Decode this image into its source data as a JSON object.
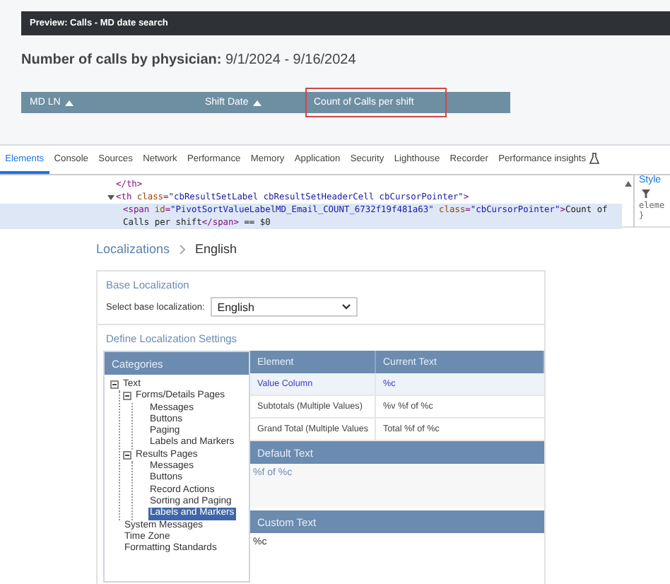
{
  "preview": {
    "title": "Preview: Calls - MD date search",
    "heading": "**Number of calls by physician:** 9/1/2024 - 9/16/2024",
    "columns": [
      {
        "label": "MD LN",
        "sorted": true,
        "highlighted": false
      },
      {
        "label": "Shift Date",
        "sorted": true,
        "highlighted": false
      },
      {
        "label": "Count of Calls per shift",
        "sorted": false,
        "highlighted": true
      }
    ]
  },
  "devtools": {
    "tabs": [
      {
        "label": "Elements",
        "selected": true
      },
      {
        "label": "Console",
        "selected": false
      },
      {
        "label": "Sources",
        "selected": false
      },
      {
        "label": "Network",
        "selected": false
      },
      {
        "label": "Performance",
        "selected": false
      },
      {
        "label": "Memory",
        "selected": false
      },
      {
        "label": "Application",
        "selected": false
      },
      {
        "label": "Security",
        "selected": false
      },
      {
        "label": "Lighthouse",
        "selected": false
      },
      {
        "label": "Recorder",
        "selected": false
      },
      {
        "label": "Performance insights",
        "selected": false,
        "kind": "experimental"
      }
    ],
    "code_lines": [
      {
        "selected": false,
        "parts": [
          {
            "kind": "tag",
            "text": "</th>"
          }
        ]
      },
      {
        "expanded": true,
        "selected": false,
        "parts": [
          {
            "kind": "tag",
            "text": "<th "
          },
          {
            "kind": "attr",
            "text": "class"
          },
          {
            "kind": "tag",
            "text": "="
          },
          {
            "kind": "value",
            "text": "\"cbResultSetLabel cbResultSetHeaderCell cbCursorPointer\""
          },
          {
            "kind": "tag",
            "text": ">"
          }
        ],
        "children": [
          {
            "selected": true,
            "parts": [
              {
                "kind": "tag",
                "text": "<span "
              },
              {
                "kind": "attr",
                "text": "id"
              },
              {
                "kind": "tag",
                "text": "="
              },
              {
                "kind": "value",
                "text": "\"PivotSortValueLabelMD_Email_COUNT_6732f19f481a63\""
              },
              {
                "kind": "attr",
                "text": " class"
              },
              {
                "kind": "tag",
                "text": "="
              },
              {
                "kind": "value",
                "text": "\"cbCursorPointer\""
              },
              {
                "kind": "tag",
                "text": ">"
              },
              {
                "kind": "text",
                "text": "Count of Calls per shift"
              },
              {
                "kind": "tag",
                "text": "</span>"
              },
              {
                "kind": "text",
                "text": " == $0"
              }
            ]
          }
        ]
      }
    ],
    "styles": {
      "tab": "Style",
      "lines": [
        "eleme",
        "}"
      ]
    }
  },
  "localization": {
    "breadcrumb": [
      "Localizations",
      "English"
    ],
    "base_title": "Base Localization",
    "select_label": "Select base localization:",
    "select_value": "English",
    "settings_title": "Define Localization Settings",
    "categories_header": "Categories",
    "tree": [
      {
        "label": "Text",
        "expanded": true,
        "selected": false,
        "children": [
          {
            "label": "Forms/Details Pages",
            "expanded": true,
            "selected": false,
            "children": [
              {
                "label": "Messages",
                "selected": false
              },
              {
                "label": "Buttons",
                "selected": false
              },
              {
                "label": "Paging",
                "selected": false
              },
              {
                "label": "Labels and Markers",
                "selected": false
              }
            ]
          },
          {
            "label": "Results Pages",
            "expanded": true,
            "selected": false,
            "children": [
              {
                "label": "Messages",
                "selected": false
              },
              {
                "label": "Buttons",
                "selected": false
              },
              {
                "label": "Record Actions",
                "selected": false
              },
              {
                "label": "Sorting and Paging",
                "selected": false
              },
              {
                "label": "Labels and Markers",
                "selected": true
              }
            ]
          }
        ]
      },
      {
        "label": "System Messages",
        "selected": false
      },
      {
        "label": "Time Zone",
        "selected": false
      },
      {
        "label": "Formatting Standards",
        "selected": false
      }
    ],
    "columns": [
      "Element",
      "Current Text"
    ],
    "rows": [
      {
        "element": "Value Column",
        "current": "%c",
        "selected": true
      },
      {
        "element": "Subtotals (Multiple Values)",
        "current": "%v %f of %c",
        "selected": false
      },
      {
        "element": "Grand Total (Multiple Values",
        "current": "Total %f of %c",
        "selected": false
      }
    ],
    "default_header": "Default Text",
    "default_text": "%f of %c",
    "custom_header": "Custom Text",
    "custom_text": "%c"
  }
}
